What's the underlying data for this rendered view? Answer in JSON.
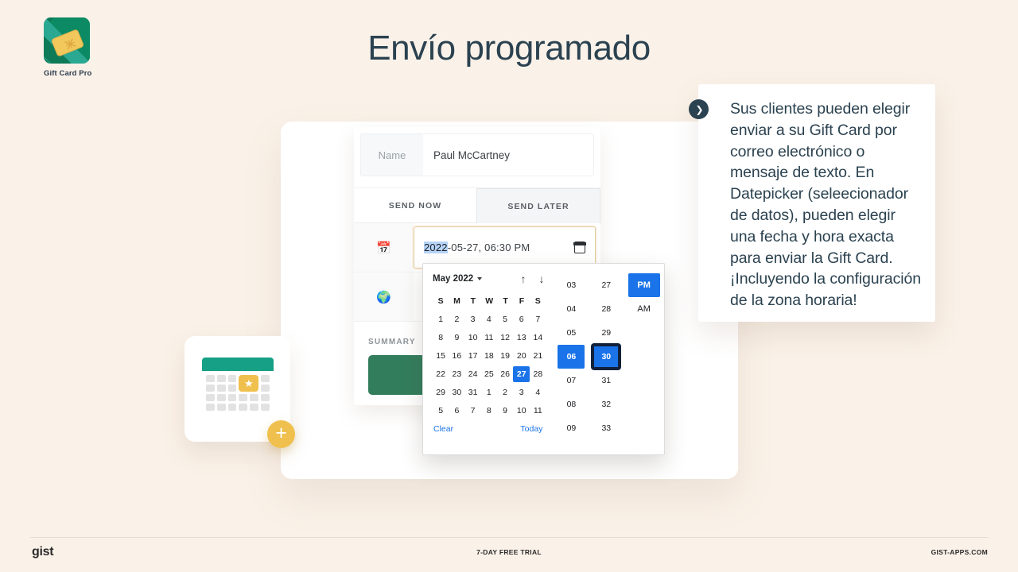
{
  "brand": {
    "label": "Gift Card Pro",
    "mark_color": "#2aa892",
    "card_color": "#f2c75c"
  },
  "page": {
    "title": "Envío programado",
    "background": "#faf1e8",
    "title_color": "#2b4250"
  },
  "form": {
    "name_label": "Name",
    "name_value": "Paul McCartney",
    "tabs": [
      {
        "label": "SEND NOW",
        "active": false
      },
      {
        "label": "SEND LATER",
        "active": true
      }
    ],
    "date_row_icon": "calendar-emoji-icon",
    "date_row_icon_glyph": "📅",
    "timezone_row_icon": "globe-emoji-icon",
    "timezone_row_icon_glyph": "🌍",
    "datetime_year": "2022",
    "datetime_rest": "-05-27, 06:30 PM",
    "datetime_full": "2022-05-27, 06:30 PM",
    "summary_label": "SUMMARY",
    "summary_button_color": "#327d5c"
  },
  "datepicker": {
    "month_label": "May 2022",
    "nav_up": "↑",
    "nav_down": "↓",
    "weekdays": [
      "S",
      "M",
      "T",
      "W",
      "T",
      "F",
      "S"
    ],
    "weeks": [
      [
        {
          "d": "1"
        },
        {
          "d": "2"
        },
        {
          "d": "3"
        },
        {
          "d": "4"
        },
        {
          "d": "5"
        },
        {
          "d": "6"
        },
        {
          "d": "7"
        }
      ],
      [
        {
          "d": "8"
        },
        {
          "d": "9"
        },
        {
          "d": "10"
        },
        {
          "d": "11"
        },
        {
          "d": "12"
        },
        {
          "d": "13"
        },
        {
          "d": "14"
        }
      ],
      [
        {
          "d": "15"
        },
        {
          "d": "16"
        },
        {
          "d": "17"
        },
        {
          "d": "18"
        },
        {
          "d": "19"
        },
        {
          "d": "20"
        },
        {
          "d": "21"
        }
      ],
      [
        {
          "d": "22"
        },
        {
          "d": "23"
        },
        {
          "d": "24"
        },
        {
          "d": "25"
        },
        {
          "d": "26"
        },
        {
          "d": "27",
          "sel": true
        },
        {
          "d": "28"
        }
      ],
      [
        {
          "d": "29"
        },
        {
          "d": "30"
        },
        {
          "d": "31"
        },
        {
          "d": "1",
          "mu": true
        },
        {
          "d": "2",
          "mu": true
        },
        {
          "d": "3",
          "mu": true
        },
        {
          "d": "4",
          "mu": true
        }
      ],
      [
        {
          "d": "5",
          "mu": true
        },
        {
          "d": "6",
          "mu": true
        },
        {
          "d": "7",
          "mu": true
        },
        {
          "d": "8",
          "mu": true
        },
        {
          "d": "9",
          "mu": true
        },
        {
          "d": "10",
          "mu": true
        },
        {
          "d": "11",
          "mu": true
        }
      ]
    ],
    "selected_day": "27",
    "clear_label": "Clear",
    "today_label": "Today",
    "hours": [
      "03",
      "04",
      "05",
      "06",
      "07",
      "08",
      "09"
    ],
    "selected_hour": "06",
    "minutes": [
      "27",
      "28",
      "29",
      "30",
      "31",
      "32",
      "33"
    ],
    "selected_minute": "30",
    "meridiem": [
      "PM",
      "AM"
    ],
    "selected_meridiem": "PM",
    "accent_color": "#1a73e8"
  },
  "callout": {
    "bullet_icon": "chevron-right-icon",
    "bullet_glyph": "❯",
    "text": "Sus clientes pueden elegir enviar a su Gift Card por correo electrónico o mensaje de texto. En Datepicker (seleecionador de datos), pueden elegir una fecha y hora exacta para enviar la Gift Card. ¡Incluyendo la configuración de la zona horaria!"
  },
  "footer": {
    "logo": "gist",
    "center": "7-DAY FREE TRIAL",
    "right": "GIST-APPS.COM"
  }
}
